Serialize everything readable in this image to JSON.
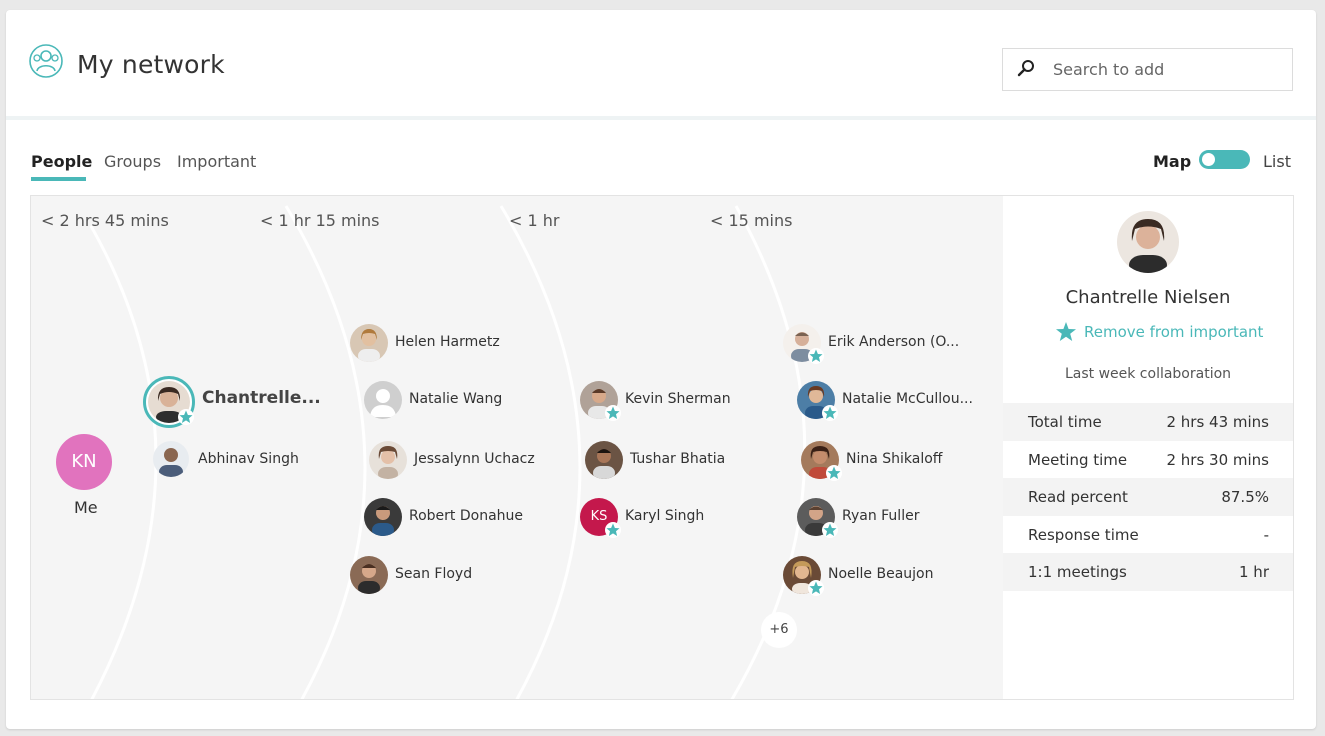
{
  "header": {
    "title": "My network",
    "search_placeholder": "Search to add"
  },
  "tabs": [
    {
      "label": "People",
      "active": true
    },
    {
      "label": "Groups",
      "active": false
    },
    {
      "label": "Important",
      "active": false
    }
  ],
  "view_toggle": {
    "map_label": "Map",
    "list_label": "List",
    "selected": "Map"
  },
  "map": {
    "bands": [
      "< 2 hrs 45 mins",
      "< 1 hr 15 mins",
      "< 1 hr",
      "< 15 mins"
    ],
    "me": {
      "initials": "KN",
      "label": "Me"
    },
    "selected_person": {
      "name": "Chantrelle...",
      "important": true
    },
    "people": [
      {
        "name": "Abhinav Singh",
        "important": false,
        "avatar_color": "#6f7f98"
      },
      {
        "name": "Helen Harmetz",
        "important": false,
        "avatar_color": "#b89a7a"
      },
      {
        "name": "Natalie Wang",
        "important": false,
        "avatar_color": "#c8c8c8"
      },
      {
        "name": "Jessalynn Uchacz",
        "important": false,
        "avatar_color": "#c9a48a"
      },
      {
        "name": "Robert Donahue",
        "important": false,
        "avatar_color": "#3e3a38"
      },
      {
        "name": "Sean Floyd",
        "important": false,
        "avatar_color": "#6b4a3a"
      },
      {
        "name": "Kevin Sherman",
        "important": true,
        "avatar_color": "#9a7a66"
      },
      {
        "name": "Tushar Bhatia",
        "important": false,
        "avatar_color": "#5b4537"
      },
      {
        "name": "Karyl Singh",
        "important": true,
        "initials": "KS",
        "avatar_color": "#c4184c"
      },
      {
        "name": "Erik Anderson (O...",
        "important": true,
        "avatar_color": "#b8a496"
      },
      {
        "name": "Natalie McCullou...",
        "important": true,
        "avatar_color": "#4d7ea6"
      },
      {
        "name": "Nina Shikaloff",
        "important": true,
        "avatar_color": "#8a5a44"
      },
      {
        "name": "Ryan Fuller",
        "important": true,
        "avatar_color": "#5c5c5c"
      },
      {
        "name": "Noelle Beaujon",
        "important": true,
        "avatar_color": "#b89060"
      }
    ],
    "more_count": "+6"
  },
  "detail": {
    "name": "Chantrelle Nielsen",
    "remove_label": "Remove from important",
    "period_label": "Last week collaboration",
    "stats": [
      {
        "label": "Total time",
        "value": "2 hrs 43 mins"
      },
      {
        "label": "Meeting time",
        "value": "2 hrs 30 mins"
      },
      {
        "label": "Read percent",
        "value": "87.5%"
      },
      {
        "label": "Response time",
        "value": "-"
      },
      {
        "label": "1:1 meetings",
        "value": "1 hr"
      }
    ]
  },
  "colors": {
    "accent": "#4ab8b8",
    "me_avatar": "#e173be",
    "map_bg": "#f5f5f5"
  }
}
